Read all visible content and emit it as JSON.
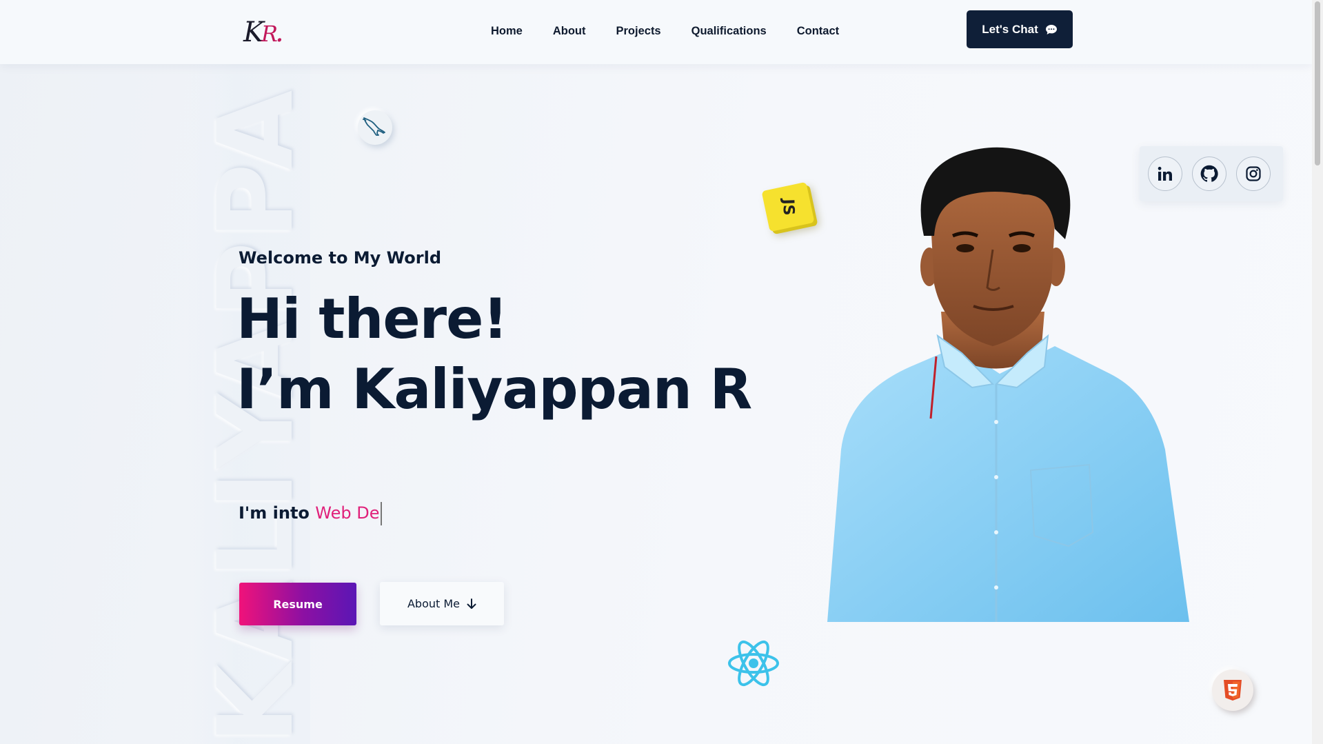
{
  "navbar": {
    "logo": {
      "k": "K",
      "r": "R",
      "dot": "."
    },
    "links": [
      "Home",
      "About",
      "Projects",
      "Qualifications",
      "Contact"
    ],
    "cta_label": "Let's Chat",
    "cta_icon": "chat-bubble-icon"
  },
  "hero": {
    "watermark": "KALIYAPPA",
    "welcome": "Welcome to My World",
    "line1": "Hi there!",
    "line2": "I’m Kaliyappan R",
    "into_prefix": "I'm into",
    "into_typed": "Web De",
    "resume_label": "Resume",
    "about_label": "About Me",
    "about_icon": "arrow-down-icon"
  },
  "social": {
    "icons": [
      "linkedin-icon",
      "github-icon",
      "instagram-icon"
    ]
  },
  "floating_icons": {
    "mysql": "mysql-dolphin-icon",
    "js": "JS",
    "react": "react-atom-icon",
    "html": "html5-icon"
  },
  "colors": {
    "navy": "#0b1b33",
    "accent_pink": "#e0207a",
    "gradient_start": "#f0127a",
    "gradient_end": "#5b16b5",
    "shirt_blue": "#8fd3f5"
  }
}
